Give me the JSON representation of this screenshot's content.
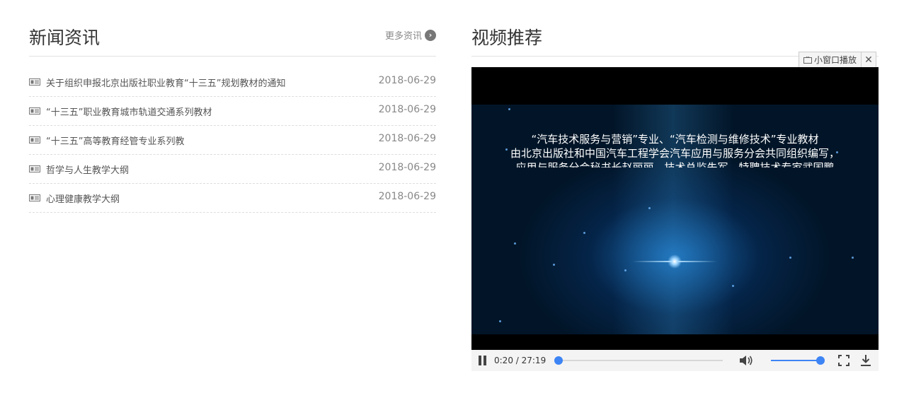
{
  "news": {
    "title": "新闻资讯",
    "more_label": "更多资讯",
    "more_icon": "chevron-right-circle-icon",
    "item_icon": "newspaper-icon",
    "items": [
      {
        "title": "关于组织申报北京出版社职业教育“十三五”规划教材的通知",
        "date": "2018-06-29"
      },
      {
        "title": "“十三五”职业教育城市轨道交通系列教材",
        "date": "2018-06-29"
      },
      {
        "title": "“十三五”高等教育经管专业系列教",
        "date": "2018-06-29"
      },
      {
        "title": "哲学与人生教学大纲",
        "date": "2018-06-29"
      },
      {
        "title": "心理健康教学大纲",
        "date": "2018-06-29"
      }
    ]
  },
  "video": {
    "title": "视频推荐",
    "pip_label": "小窗口播放",
    "close_label": "✕",
    "caption_lines": [
      "“汽车技术服务与营销”专业、“汽车检测与维修技术”专业教材",
      "由北京出版社和中国汽车工程学会汽车应用与服务分会共同组织编写，",
      "应用与服务分会秘书长赵丽丽、技术总监朱军、特聘技术专家武国鹏"
    ],
    "current_time": "0:20",
    "duration": "27:19",
    "time_display": "0:20 / 27:19",
    "progress_fraction": 0.012,
    "volume_fraction": 1.0,
    "accent_color": "#3d84f5"
  }
}
